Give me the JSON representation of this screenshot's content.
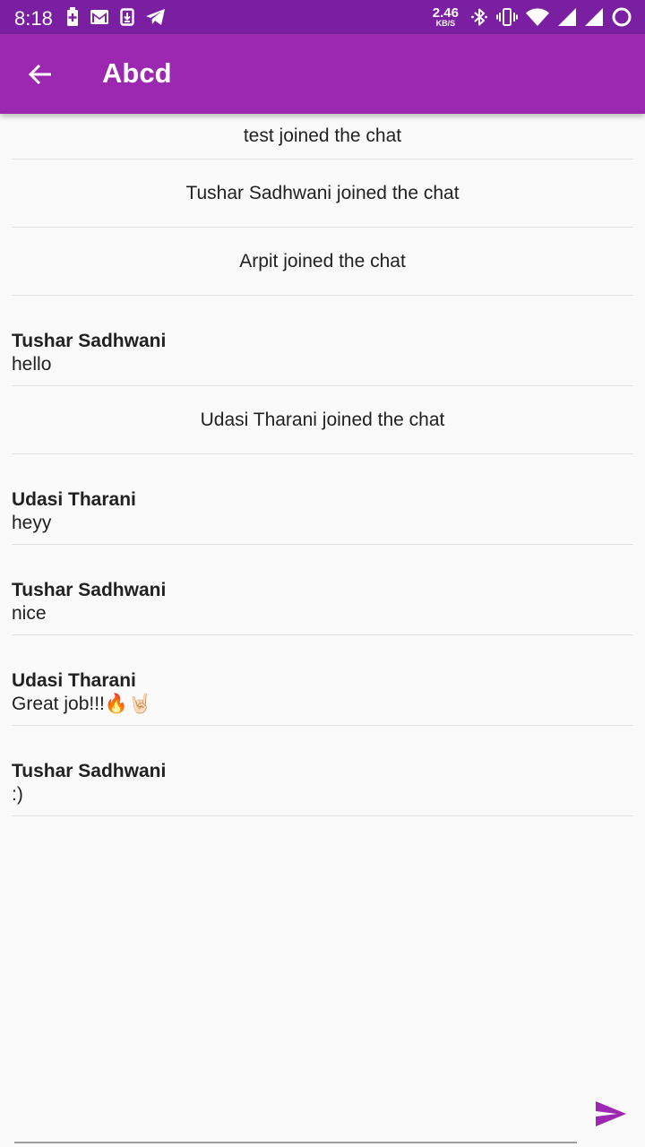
{
  "status_bar": {
    "time": "8:18",
    "net_speed": "2.46",
    "net_unit": "KB/S",
    "icons_left": [
      "battery-plus-icon",
      "gmail-icon",
      "download-icon",
      "telegram-icon"
    ],
    "icons_right": [
      "bluetooth-icon",
      "vibrate-icon",
      "wifi-icon",
      "signal-icon",
      "signal-icon",
      "circle-icon"
    ]
  },
  "app_bar": {
    "title": "Abcd",
    "back_icon": "arrow-back-icon"
  },
  "messages": [
    {
      "type": "system",
      "text": "test joined the chat"
    },
    {
      "type": "system",
      "text": "Tushar Sadhwani joined the chat"
    },
    {
      "type": "system",
      "text": "Arpit joined the chat"
    },
    {
      "type": "user",
      "author": "Tushar Sadhwani",
      "text": "hello"
    },
    {
      "type": "system",
      "text": "Udasi Tharani joined the chat"
    },
    {
      "type": "user",
      "author": "Udasi Tharani",
      "text": "heyy"
    },
    {
      "type": "user",
      "author": "Tushar Sadhwani",
      "text": "nice"
    },
    {
      "type": "user",
      "author": "Udasi Tharani",
      "text": "Great job!!!🔥🤘🏻"
    },
    {
      "type": "user",
      "author": "Tushar Sadhwani",
      "text": ":)"
    }
  ],
  "composer": {
    "value": "",
    "send_icon": "send-icon"
  },
  "colors": {
    "status_bar": "#7b1fa2",
    "app_bar": "#9c27b0",
    "accent": "#9c27b0",
    "background": "#fafafa"
  }
}
